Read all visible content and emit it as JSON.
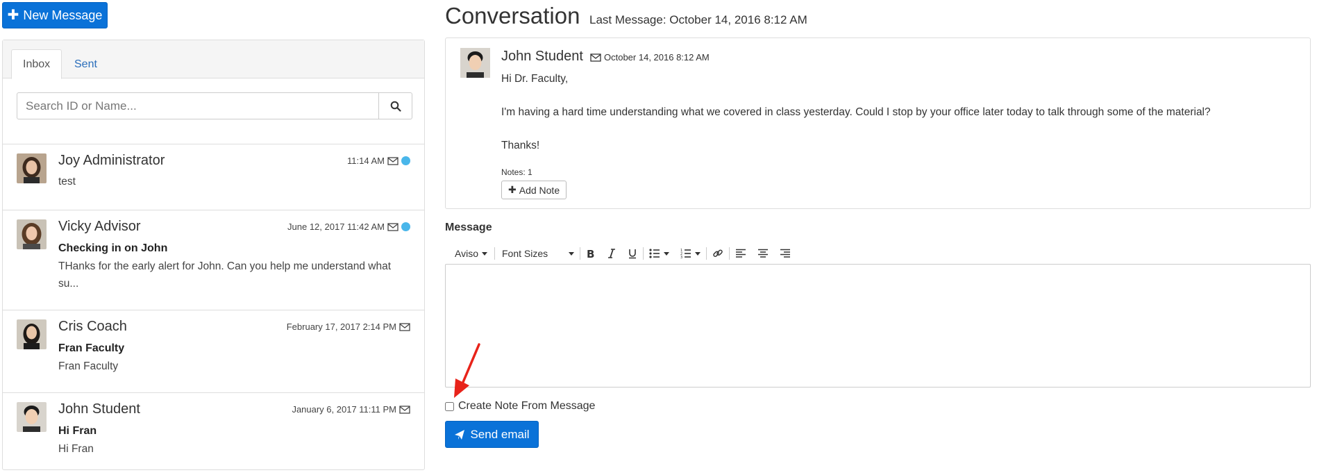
{
  "toolbar": {
    "new_message_label": "New Message"
  },
  "inbox_panel": {
    "tabs": [
      {
        "label": "Inbox",
        "active": true
      },
      {
        "label": "Sent",
        "active": false
      }
    ],
    "search": {
      "placeholder": "Search ID or Name..."
    },
    "messages": [
      {
        "name": "Joy Administrator",
        "time": "11:14 AM",
        "subject": "",
        "preview": "test",
        "unread": true
      },
      {
        "name": "Vicky Advisor",
        "time": "June 12, 2017 11:42 AM",
        "subject": "Checking in on John",
        "preview": "THanks for the early alert for John.  Can you help me understand what su...",
        "unread": true
      },
      {
        "name": "Cris Coach",
        "time": "February 17, 2017 2:14 PM",
        "subject": "Fran Faculty",
        "preview": "Fran Faculty",
        "unread": false
      },
      {
        "name": "John Student",
        "time": "January 6, 2017 11:11 PM",
        "subject": "Hi Fran",
        "preview": "Hi Fran",
        "unread": false
      }
    ]
  },
  "conversation": {
    "title": "Conversation",
    "last_message": "Last Message: October 14, 2016 8:12 AM",
    "message": {
      "sender": "John Student",
      "date": "October 14, 2016 8:12 AM",
      "body": [
        "Hi Dr. Faculty,",
        "I'm having a hard time understanding what we covered in class yesterday. Could I stop by your office later today to talk through some of the material?",
        "Thanks!"
      ],
      "notes": "Notes: 1",
      "add_note_label": "Add Note"
    }
  },
  "compose": {
    "label": "Message",
    "font_select": "Aviso",
    "size_select": "Font Sizes",
    "toolbar_icons": [
      "bold-icon",
      "italic-icon",
      "underline-icon",
      "unordered-list-icon",
      "ordered-list-icon",
      "link-icon",
      "align-left-icon",
      "align-center-icon",
      "align-right-icon"
    ],
    "create_note_label": "Create Note From Message",
    "create_note_checked": false,
    "send_label": "Send email"
  },
  "colors": {
    "primary": "#0a72d8",
    "link": "#2a6ebb",
    "unread_dot": "#49b6ea",
    "annotation_arrow": "#e8231a"
  }
}
